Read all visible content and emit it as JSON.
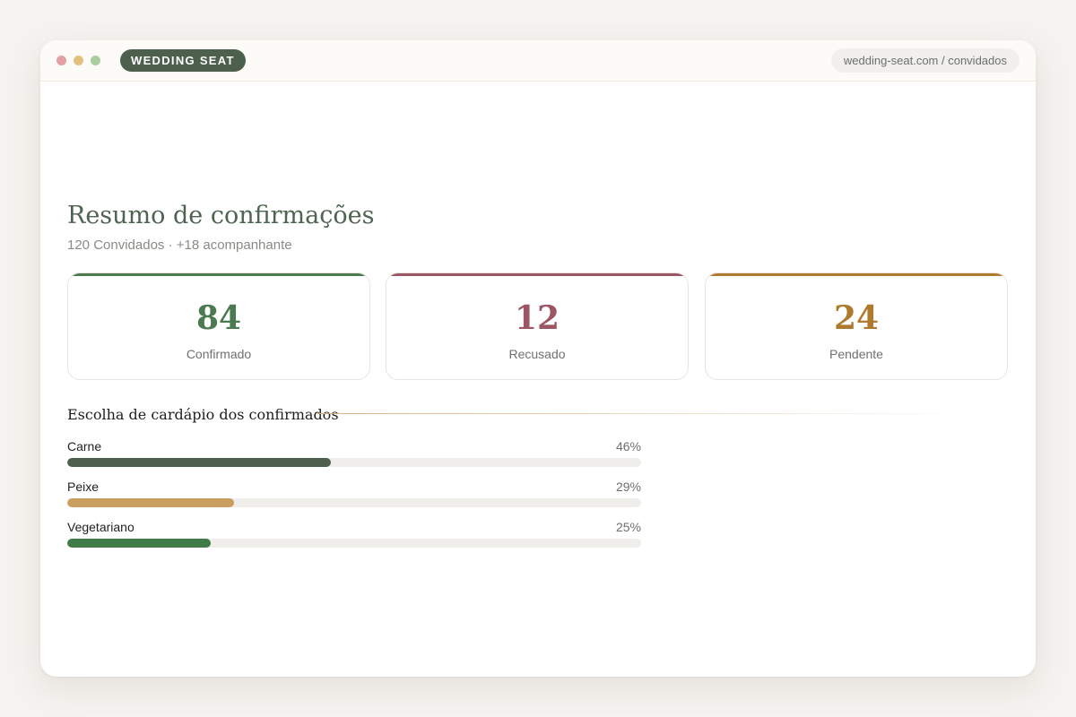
{
  "browser": {
    "brand_label": "WEDDING SEAT",
    "url": "wedding-seat.com / convidados"
  },
  "summary": {
    "title": "Resumo de confirmações",
    "subtitle": "120 Convidados · +18 acompanhante",
    "cards": [
      {
        "value": "84",
        "label": "Confirmado",
        "color": "#4a7a4f"
      },
      {
        "value": "12",
        "label": "Recusado",
        "color": "#9c5663"
      },
      {
        "value": "24",
        "label": "Pendente",
        "color": "#b07a2e"
      }
    ]
  },
  "menu": {
    "title": "Escolha de cardápio dos confirmados",
    "options": [
      {
        "label": "Carne",
        "percent_label": "46%",
        "value": 46,
        "color": "#4d5f4d"
      },
      {
        "label": "Peixe",
        "percent_label": "29%",
        "value": 29,
        "color": "#c99e5e"
      },
      {
        "label": "Vegetariano",
        "percent_label": "25%",
        "value": 25,
        "color": "#3f7a47"
      }
    ]
  }
}
